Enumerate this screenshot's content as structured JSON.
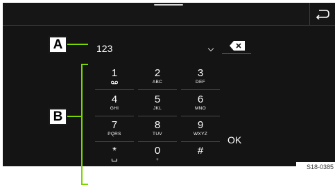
{
  "screen": {
    "number_input": {
      "value": "123"
    },
    "keypad": [
      {
        "digit": "1",
        "letters": "",
        "icon": "voicemail-icon"
      },
      {
        "digit": "2",
        "letters": "ABC"
      },
      {
        "digit": "3",
        "letters": "DEF"
      },
      {
        "digit": "4",
        "letters": "GHI"
      },
      {
        "digit": "5",
        "letters": "JKL"
      },
      {
        "digit": "6",
        "letters": "MNO"
      },
      {
        "digit": "7",
        "letters": "PQRS"
      },
      {
        "digit": "8",
        "letters": "TUV"
      },
      {
        "digit": "9",
        "letters": "WXYZ"
      },
      {
        "digit": "*",
        "letters": "",
        "icon": "space-icon"
      },
      {
        "digit": "0",
        "letters": "+"
      },
      {
        "digit": "#",
        "letters": ""
      }
    ],
    "ok_label": "OK",
    "icons": {
      "back": "back-arrow-icon",
      "delete": "backspace-icon",
      "dropdown": "chevron-down-icon"
    }
  },
  "annotations": {
    "marker_a": "A",
    "marker_b": "B",
    "image_code": "S18-0385",
    "accent_color": "#7bd600"
  }
}
